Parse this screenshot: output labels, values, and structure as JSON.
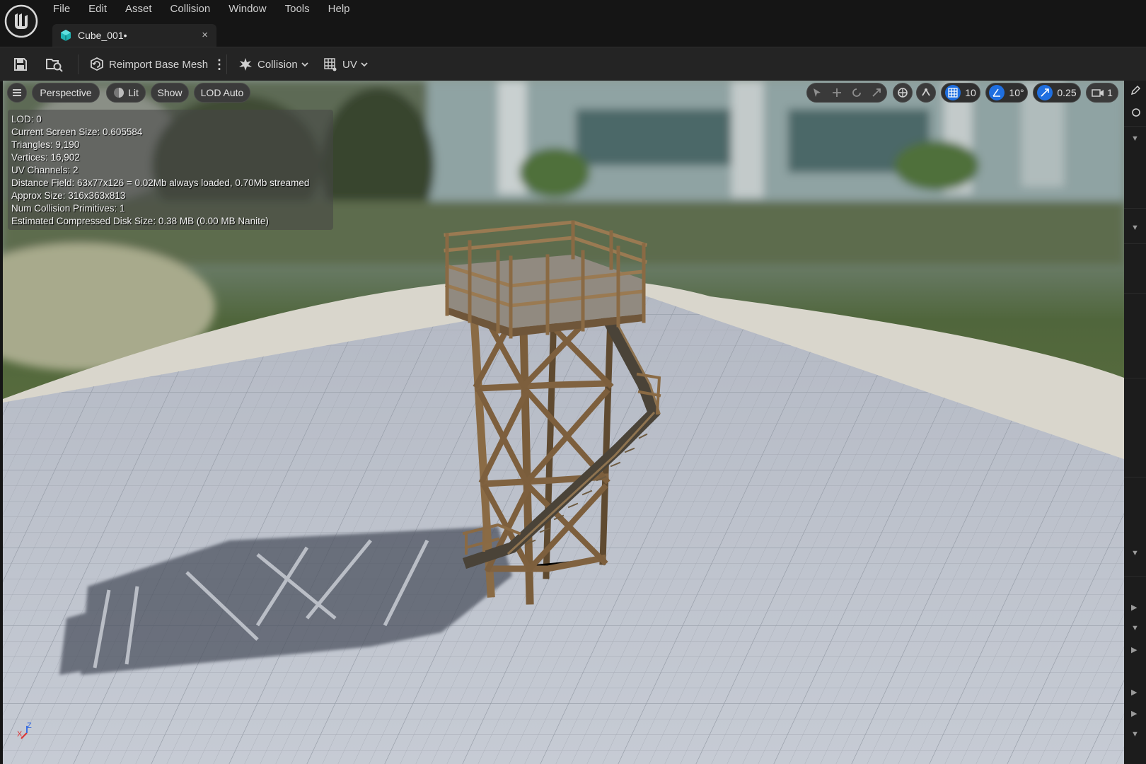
{
  "menu": {
    "items": [
      "File",
      "Edit",
      "Asset",
      "Collision",
      "Window",
      "Tools",
      "Help"
    ]
  },
  "tab": {
    "title": "Cube_001•",
    "close": "×"
  },
  "toolbar": {
    "reimport_label": "Reimport Base Mesh",
    "more_label": "⋮",
    "collision_label": "Collision",
    "uv_label": "UV"
  },
  "viewport_bar": {
    "view_mode": "Perspective",
    "lighting": "Lit",
    "show": "Show",
    "lod": "LOD Auto",
    "grid_snap": "10",
    "rotation_snap": "10°",
    "scale_snap": "0.25",
    "camera_speed": "1"
  },
  "stats": [
    "LOD: 0",
    "Current Screen Size: 0.605584",
    "Triangles: 9,190",
    "Vertices: 16,902",
    "UV Channels: 2",
    "Distance Field: 63x77x126 = 0.02Mb always loaded, 0.70Mb streamed",
    "Approx Size: 316x363x813",
    "Num Collision Primitives: 1",
    "Estimated Compressed Disk Size: 0.38 MB (0.00 MB Nanite)"
  ],
  "axis": {
    "z": "Z",
    "x": "X"
  },
  "side_panel": {
    "arrows": [
      "▼",
      "▼",
      "▼",
      "▶",
      "▼",
      "▶",
      "▶",
      "▶",
      "▼"
    ]
  },
  "colors": {
    "accent": "#1f6fe0",
    "background": "#151515",
    "panel": "#242424"
  }
}
